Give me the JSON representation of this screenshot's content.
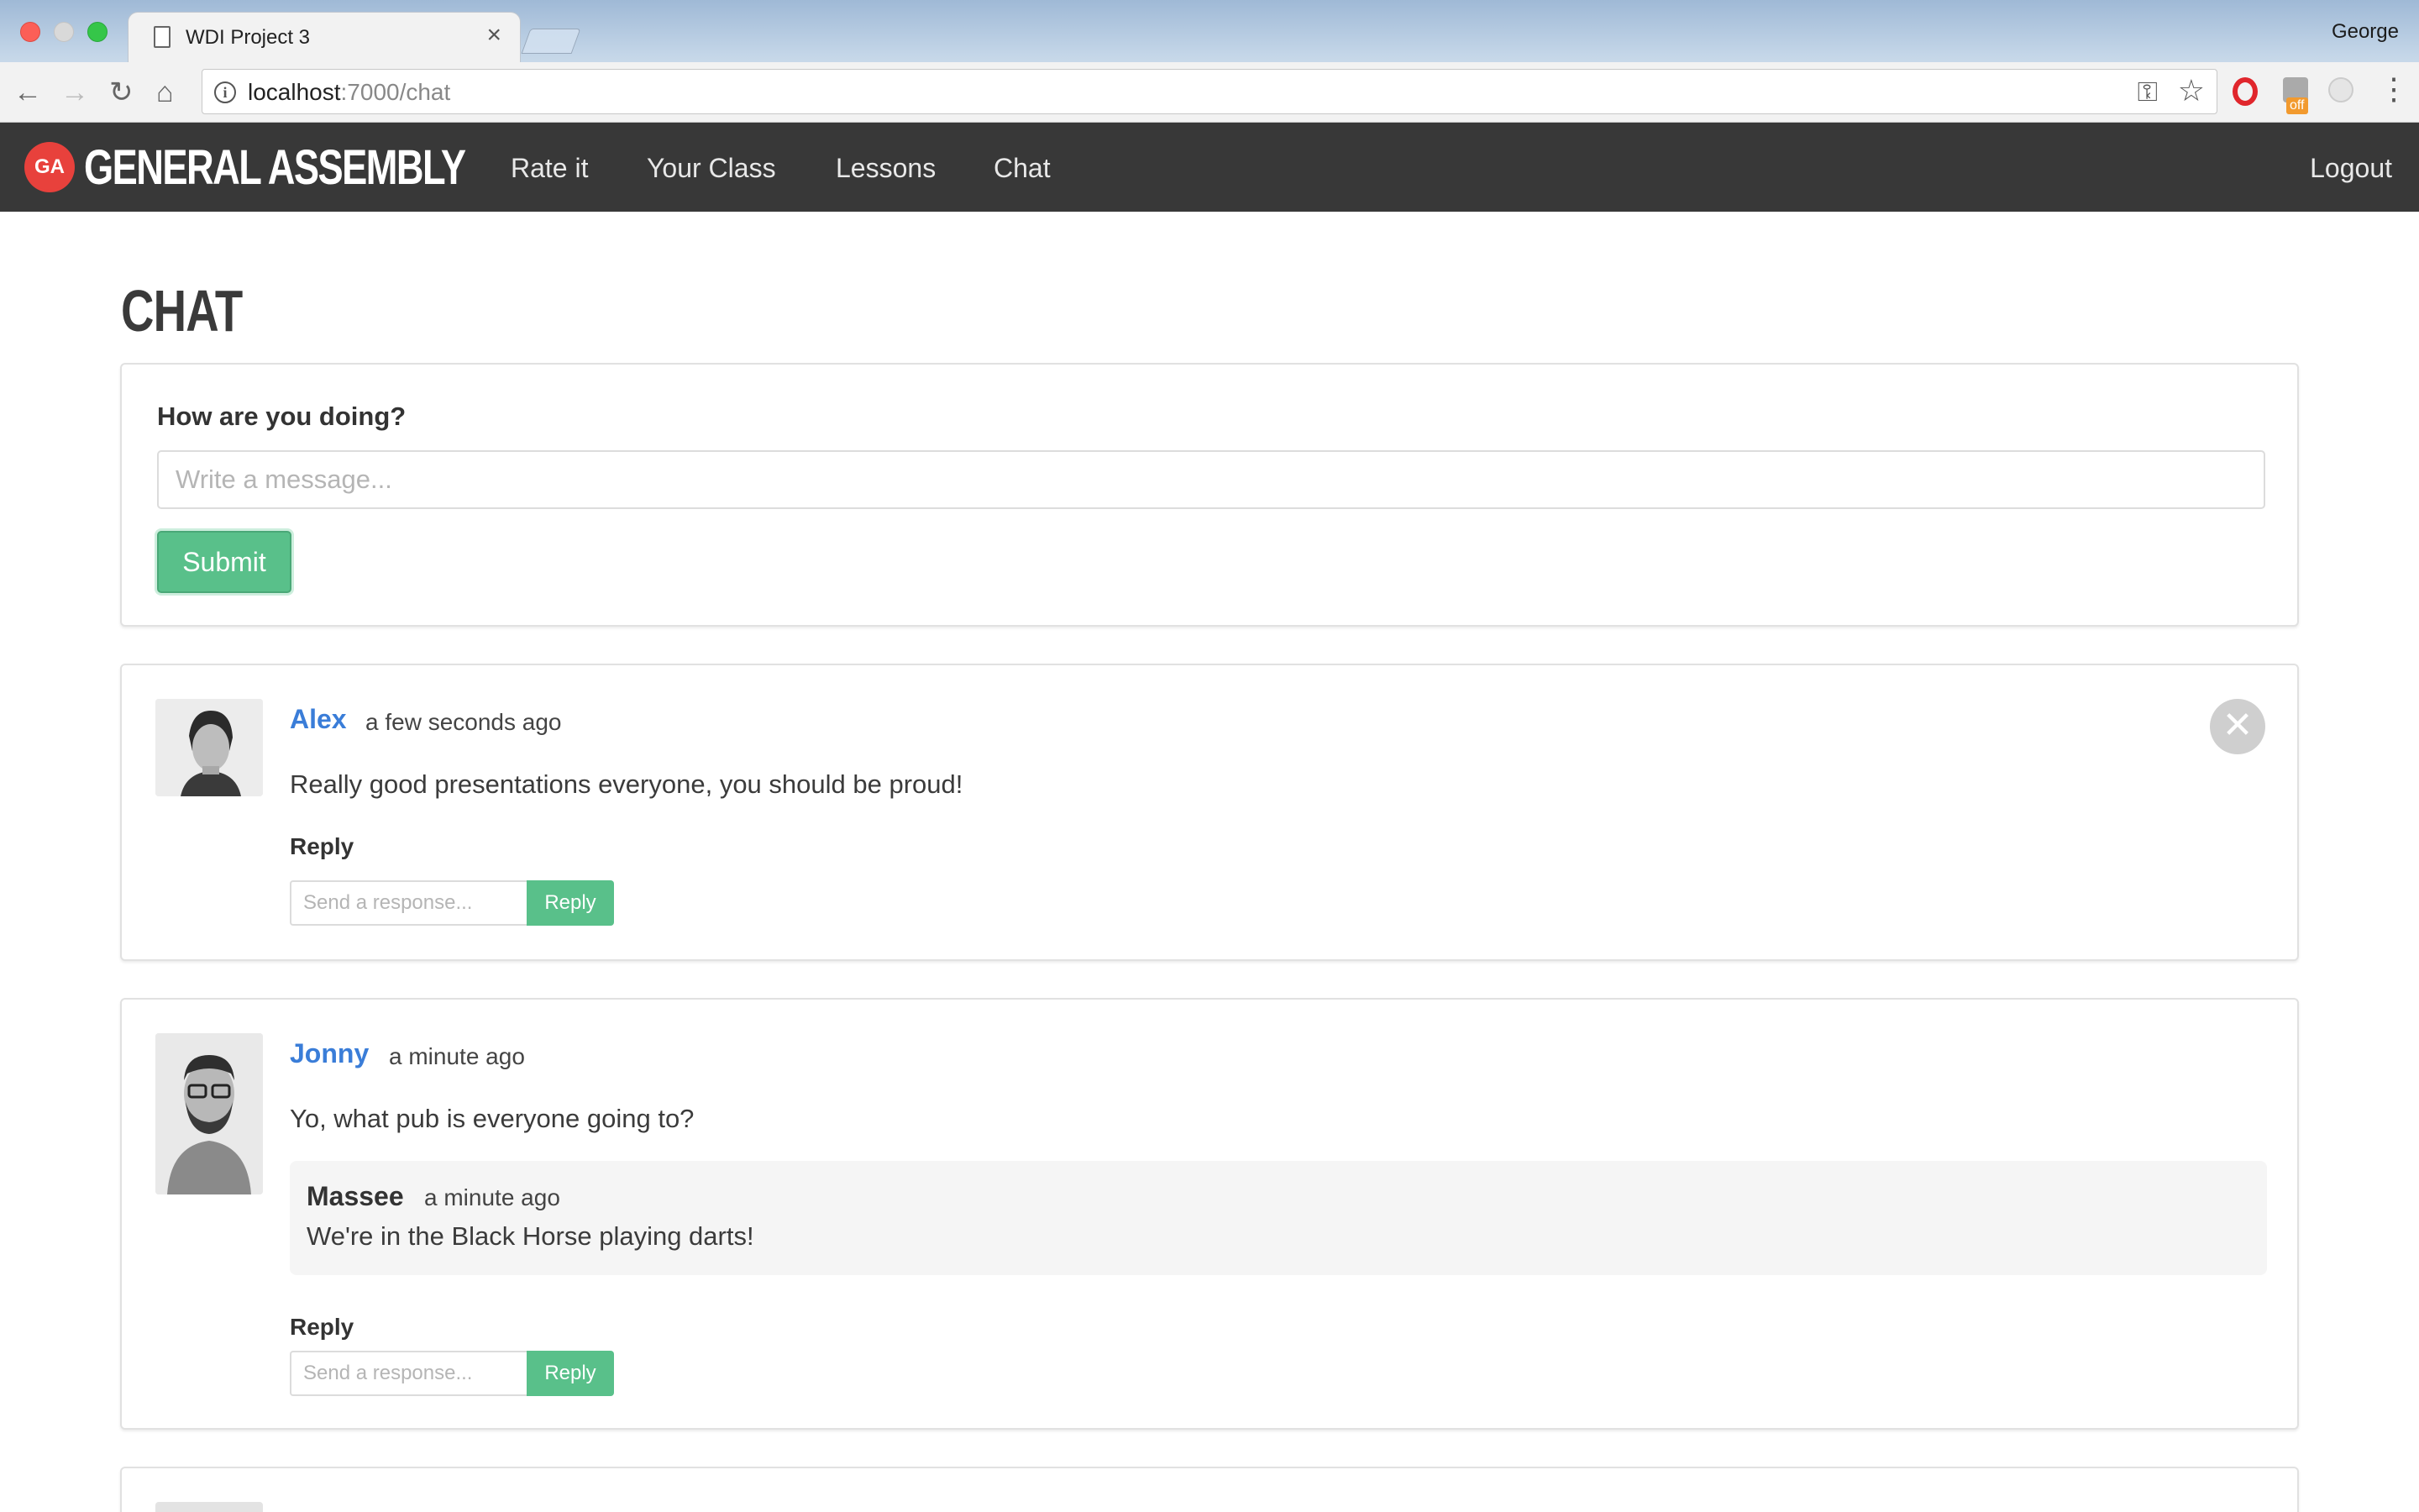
{
  "browser": {
    "tab_title": "WDI Project 3",
    "tab_close": "×",
    "profile_name": "George",
    "url_host": "localhost",
    "url_path": ":7000/chat",
    "ext_badge": "off"
  },
  "navbar": {
    "brand_badge": "GA",
    "brand_text": "GENERAL ASSEMBLY",
    "links": [
      "Rate it",
      "Your Class",
      "Lessons",
      "Chat"
    ],
    "logout": "Logout"
  },
  "page": {
    "title": "CHAT"
  },
  "compose": {
    "label": "How are you doing?",
    "placeholder": "Write a message...",
    "submit_label": "Submit"
  },
  "messages": [
    {
      "author": "Alex",
      "time": "a few seconds ago",
      "body": "Really good presentations everyone, you should be proud!",
      "reply_label": "Reply",
      "reply_placeholder": "Send a response...",
      "reply_button": "Reply",
      "replies": []
    },
    {
      "author": "Jonny",
      "time": "a minute ago",
      "body": "Yo, what pub is everyone going to?",
      "reply_label": "Reply",
      "reply_placeholder": "Send a response...",
      "reply_button": "Reply",
      "replies": [
        {
          "author": "Massee",
          "time": "a minute ago",
          "body": "We're in the Black Horse playing darts!"
        }
      ]
    }
  ],
  "icons": {
    "delete": "close-circle-icon"
  },
  "colors": {
    "navbar_bg": "#383838",
    "brand_red": "#e8413c",
    "accent_green": "#59c08a",
    "author_blue": "#3a7dd8"
  }
}
